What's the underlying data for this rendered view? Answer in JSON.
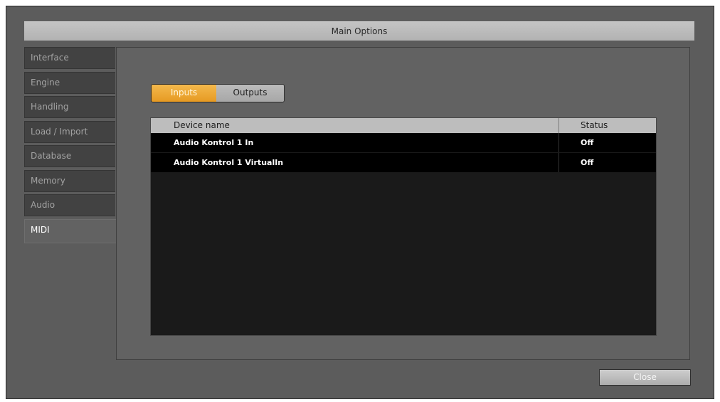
{
  "window": {
    "title": "Main Options"
  },
  "tabs": [
    {
      "label": "Interface",
      "active": false
    },
    {
      "label": "Engine",
      "active": false
    },
    {
      "label": "Handling",
      "active": false
    },
    {
      "label": "Load / Import",
      "active": false
    },
    {
      "label": "Database",
      "active": false
    },
    {
      "label": "Memory",
      "active": false
    },
    {
      "label": "Audio",
      "active": false
    },
    {
      "label": "MIDI",
      "active": true
    }
  ],
  "io_toggle": {
    "inputs_label": "Inputs",
    "outputs_label": "Outputs",
    "selected": "Inputs"
  },
  "device_table": {
    "columns": {
      "name": "Device name",
      "status": "Status"
    },
    "rows": [
      {
        "name": "Audio Kontrol 1 In",
        "status": "Off"
      },
      {
        "name": "Audio Kontrol 1 VirtualIn",
        "status": "Off"
      }
    ]
  },
  "footer": {
    "close_label": "Close"
  },
  "colors": {
    "accent": "#eea83a",
    "window_bg": "#5c5c5c",
    "panel_bg": "#626262",
    "table_bg": "#1a1a1a"
  }
}
